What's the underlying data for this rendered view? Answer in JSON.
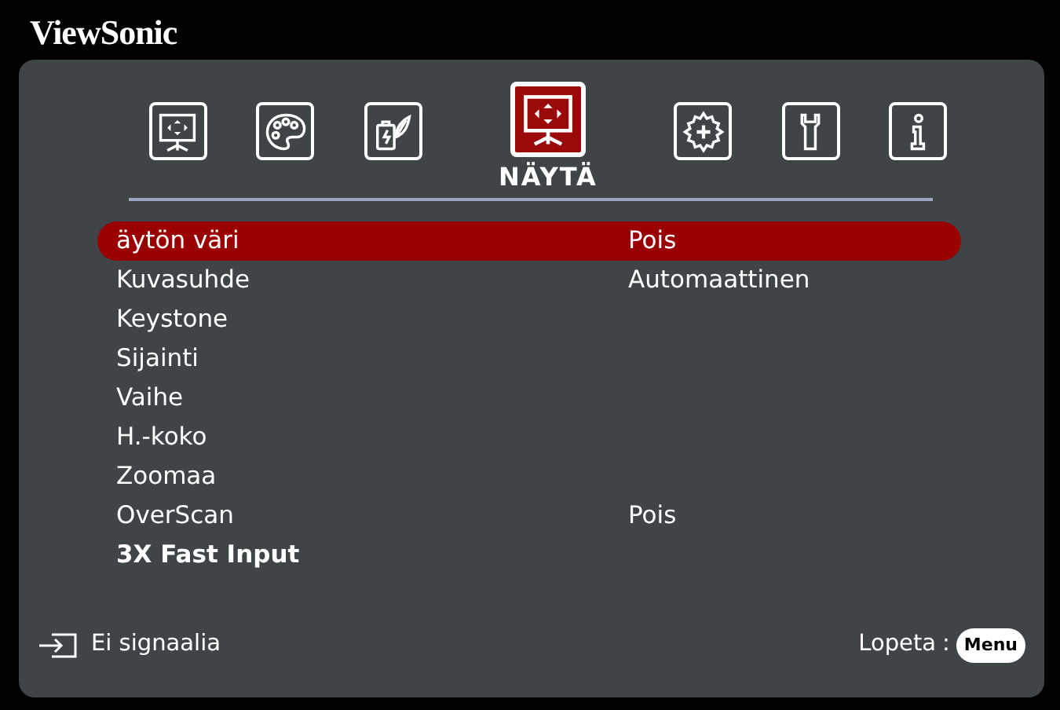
{
  "brand": "ViewSonic",
  "tabs": [
    {
      "kind": "display",
      "selected": false
    },
    {
      "kind": "palette",
      "selected": false
    },
    {
      "kind": "power",
      "selected": false
    },
    {
      "kind": "display",
      "selected": true
    },
    {
      "kind": "gear",
      "selected": false
    },
    {
      "kind": "wrench",
      "selected": false
    },
    {
      "kind": "info",
      "selected": false
    }
  ],
  "section_title": "NÄYTÄ",
  "menu": [
    {
      "label": "äytön väri",
      "value": "Pois",
      "selected": true,
      "bold": false
    },
    {
      "label": "Kuvasuhde",
      "value": "Automaattinen",
      "selected": false,
      "bold": false
    },
    {
      "label": "Keystone",
      "selected": false,
      "bold": false
    },
    {
      "label": "Sijainti",
      "selected": false,
      "bold": false
    },
    {
      "label": "Vaihe",
      "selected": false,
      "bold": false
    },
    {
      "label": "H.-koko",
      "selected": false,
      "bold": false
    },
    {
      "label": "Zoomaa",
      "selected": false,
      "bold": false
    },
    {
      "label": "OverScan",
      "value": "Pois",
      "selected": false,
      "bold": false
    },
    {
      "label": "3X Fast Input",
      "selected": false,
      "bold": true
    }
  ],
  "status_bar": {
    "signal": "Ei signaalia",
    "exit_label": "Lopeta",
    "separator": ":",
    "exit_key": "Menu"
  }
}
